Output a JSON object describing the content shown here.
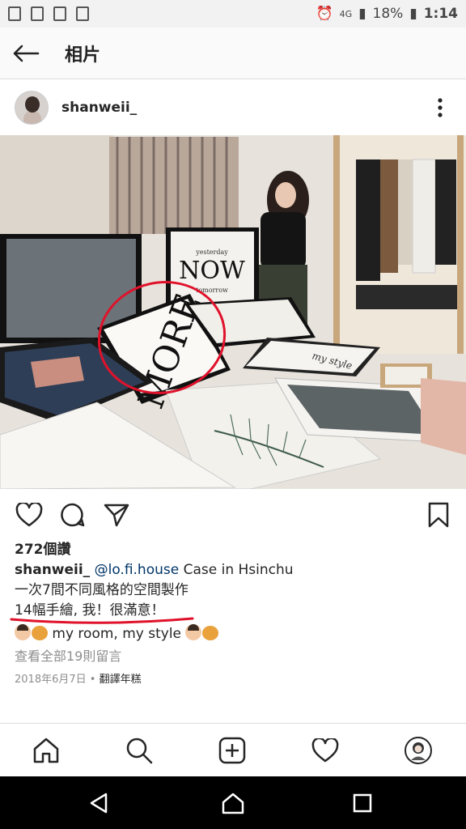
{
  "status": {
    "network": "4G",
    "battery": "18%",
    "time": "1:14"
  },
  "header": {
    "title": "相片"
  },
  "post": {
    "username": "shanweii_",
    "likes": "272個讚",
    "caption": {
      "user": "shanweii_",
      "mention": "@lo.fi.house",
      "line1": "Case in Hsinchu",
      "line2": "一次7間不同風格的空間製作",
      "line3": "14幅手繪, 我！很滿意！",
      "line4": "my room, my style"
    },
    "view_comments": "查看全部19則留言",
    "date": "2018年6月7日",
    "translate": "翻譯年糕"
  },
  "photo_art": {
    "poster_title": "NOW",
    "poster_top": "yesterday",
    "poster_bottom": "tomorrow",
    "big_word": "MORE",
    "script_text": "my style"
  },
  "colors": {
    "accent_mention": "#003569",
    "annotation": "#e0122b"
  }
}
